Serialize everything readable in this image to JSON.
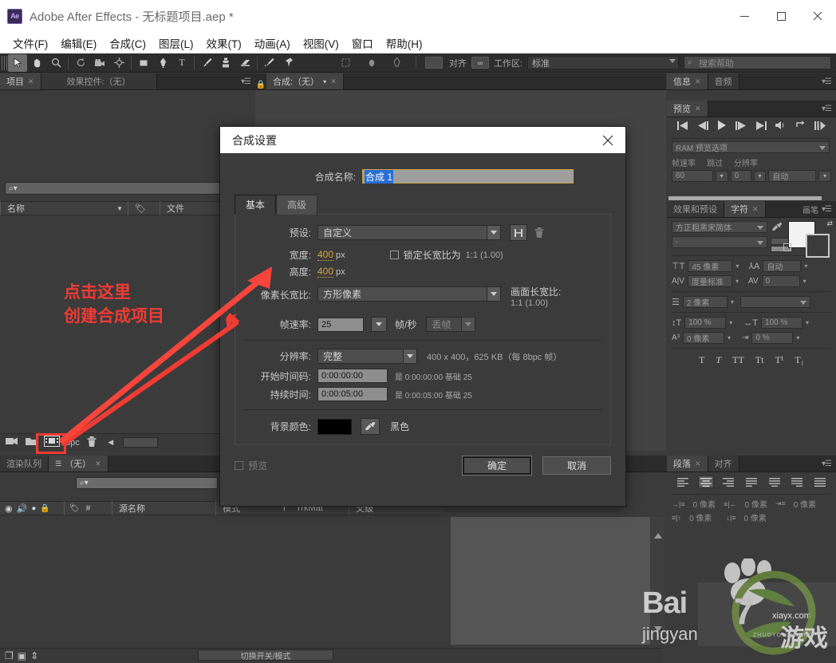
{
  "window": {
    "title": "Adobe After Effects - 无标题项目.aep *",
    "logo_text": "Ae",
    "minimize": "—",
    "maximize": "□",
    "close": "✕"
  },
  "menubar": {
    "items": [
      {
        "label": "文件(F)"
      },
      {
        "label": "编辑(E)"
      },
      {
        "label": "合成(C)"
      },
      {
        "label": "图层(L)"
      },
      {
        "label": "效果(T)"
      },
      {
        "label": "动画(A)"
      },
      {
        "label": "视图(V)"
      },
      {
        "label": "窗口"
      },
      {
        "label": "帮助(H)"
      }
    ]
  },
  "toolbar": {
    "tools": [
      {
        "name": "selection-tool",
        "glyph": "➤"
      },
      {
        "name": "hand-tool",
        "glyph": "✋"
      },
      {
        "name": "zoom-tool",
        "glyph": "🔍"
      },
      {
        "name": "rotation-tool",
        "glyph": "↺"
      },
      {
        "name": "camera-tool",
        "glyph": "🎥"
      },
      {
        "name": "anchor-point-tool",
        "glyph": "⊕"
      },
      {
        "name": "shape-tool",
        "glyph": "▪"
      },
      {
        "name": "pen-tool",
        "glyph": "✒"
      },
      {
        "name": "type-tool",
        "glyph": "T"
      },
      {
        "name": "brush-tool",
        "glyph": "🖌"
      },
      {
        "name": "clone-stamp-tool",
        "glyph": "⎘"
      },
      {
        "name": "eraser-tool",
        "glyph": "◢"
      },
      {
        "name": "roto-brush-tool",
        "glyph": "✂"
      },
      {
        "name": "puppet-pin-tool",
        "glyph": "📌"
      }
    ],
    "snap_label": "对齐",
    "workspace_label": "工作区:",
    "workspace_value": "标准",
    "search_placeholder": "搜索帮助"
  },
  "project_panel": {
    "tabs": [
      {
        "label": "项目",
        "active": true,
        "closable": true
      },
      {
        "label": "效果控件:（无）",
        "active": false,
        "closable": false
      }
    ],
    "search_placeholder": "",
    "columns": [
      "名称",
      "文件"
    ],
    "bottom": {
      "bpc_label": "bpc",
      "icons": [
        "interpret-footage-icon",
        "new-folder-icon",
        "new-composition-icon",
        "delete-icon"
      ]
    }
  },
  "comp_panel": {
    "tabs": [
      {
        "label": "合成:（无）",
        "active": true
      }
    ]
  },
  "annotation": {
    "line1": "点击这里",
    "line2": "创建合成项目",
    "color": "#f03b33"
  },
  "info_panel": {
    "tabs": [
      {
        "label": "信息",
        "active": true
      },
      {
        "label": "音频",
        "active": false
      }
    ]
  },
  "preview_panel": {
    "tabs": [
      {
        "label": "预览",
        "active": true
      }
    ],
    "transport": [
      "first-frame-icon",
      "prev-frame-icon",
      "play-icon",
      "next-frame-icon",
      "last-frame-icon",
      "audio-icon",
      "loop-icon",
      "ram-preview-icon"
    ],
    "ram_preview_label": "RAM 预览选项",
    "fields": [
      {
        "label": "帧速率",
        "value": "60"
      },
      {
        "label": "跳过",
        "value": "0"
      },
      {
        "label": "分辨率",
        "value": "自动"
      }
    ]
  },
  "character_panel": {
    "tabs": [
      {
        "label": "效果和预设",
        "active": false
      },
      {
        "label": "字符",
        "active": true
      },
      {
        "label": "画笔",
        "active": false
      }
    ],
    "font_family": "方正粗黑宋简体",
    "font_style": "-",
    "font_size": "45 像素",
    "leading": "自动",
    "tracking_label": "度量标准",
    "tracking_value": "0",
    "stroke_width": "2 像素",
    "vertical_scale": "100 %",
    "horizontal_scale": "100 %",
    "baseline_shift": "0 像素",
    "tsume": "0 %",
    "style_buttons": [
      "T",
      "T",
      "TT",
      "Tt",
      "T¹",
      "T₁"
    ]
  },
  "paragraph_panel": {
    "tabs": [
      {
        "label": "段落",
        "active": true
      },
      {
        "label": "对齐",
        "active": false
      }
    ],
    "align_buttons": [
      "align-left-icon",
      "align-center-icon",
      "align-right-icon",
      "justify-last-left-icon",
      "justify-last-center-icon",
      "justify-last-right-icon",
      "justify-all-icon"
    ],
    "indents": [
      {
        "icon": "indent-left-icon",
        "value": "0 像素"
      },
      {
        "icon": "indent-right-icon",
        "value": "0 像素"
      },
      {
        "icon": "indent-first-line-icon",
        "value": "0 像素"
      },
      {
        "icon": "space-before-icon",
        "value": "0 像素"
      },
      {
        "icon": "space-after-icon",
        "value": "0 像素"
      }
    ]
  },
  "timeline_panel": {
    "tabs": [
      {
        "label": "渲染队列",
        "active": false
      },
      {
        "label": "（无）",
        "active": true
      }
    ],
    "search_placeholder": "",
    "columns": [
      "源名称",
      "模式",
      "T",
      "TrkMat",
      "父级"
    ],
    "eye_icons": [
      "eye-icon",
      "audio-icon",
      "solo-icon",
      "lock-icon"
    ],
    "toggle_switches_label": "切换开关/模式"
  },
  "dialog": {
    "title": "合成设置",
    "close_glyph": "✕",
    "comp_name_label": "合成名称:",
    "comp_name_value": "合成 1",
    "tabs": [
      {
        "label": "基本",
        "active": true
      },
      {
        "label": "高级",
        "active": false
      }
    ],
    "preset_label": "预设:",
    "preset_value": "自定义",
    "preset_save_icon": "save-preset-icon",
    "preset_delete_icon": "trash-icon",
    "width_label": "宽度:",
    "width_value": "400",
    "width_unit": "px",
    "height_label": "高度:",
    "height_value": "400",
    "height_unit": "px",
    "lock_aspect_label": "锁定长宽比为",
    "lock_aspect_ratio": "1:1 (1.00)",
    "lock_aspect_checked": false,
    "pixel_aspect_label": "像素长宽比:",
    "pixel_aspect_value": "方形像素",
    "frame_aspect_label": "画面长宽比:",
    "frame_aspect_value": "1:1 (1.00)",
    "framerate_label": "帧速率:",
    "framerate_value": "25",
    "framerate_unit": "帧/秒",
    "dropframe_value": "丢帧",
    "resolution_label": "分辨率:",
    "resolution_value": "完整",
    "resolution_info": "400 x 400，625 KB（每 8bpc 帧）",
    "start_tc_label": "开始时间码:",
    "start_tc_value": "0:00:00:00",
    "start_tc_note": "是 0:00:00:00 基础 25",
    "duration_label": "持续时间:",
    "duration_value": "0:00:05:00",
    "duration_note": "是 0:00:05:00 基础 25",
    "bg_color_label": "背景颜色:",
    "bg_color_value": "#000000",
    "bg_color_name": "黑色",
    "eyedropper_icon": "eyedropper-icon",
    "preview_label": "预览",
    "preview_checked": false,
    "ok_label": "确定",
    "cancel_label": "取消"
  },
  "watermark": {
    "baidu_line1": "Bai",
    "baidu_line2": "jingyan",
    "site": "xiayx.com",
    "game_text": "游戏",
    "pinyin": "ZHUOYOUXIWANG"
  }
}
